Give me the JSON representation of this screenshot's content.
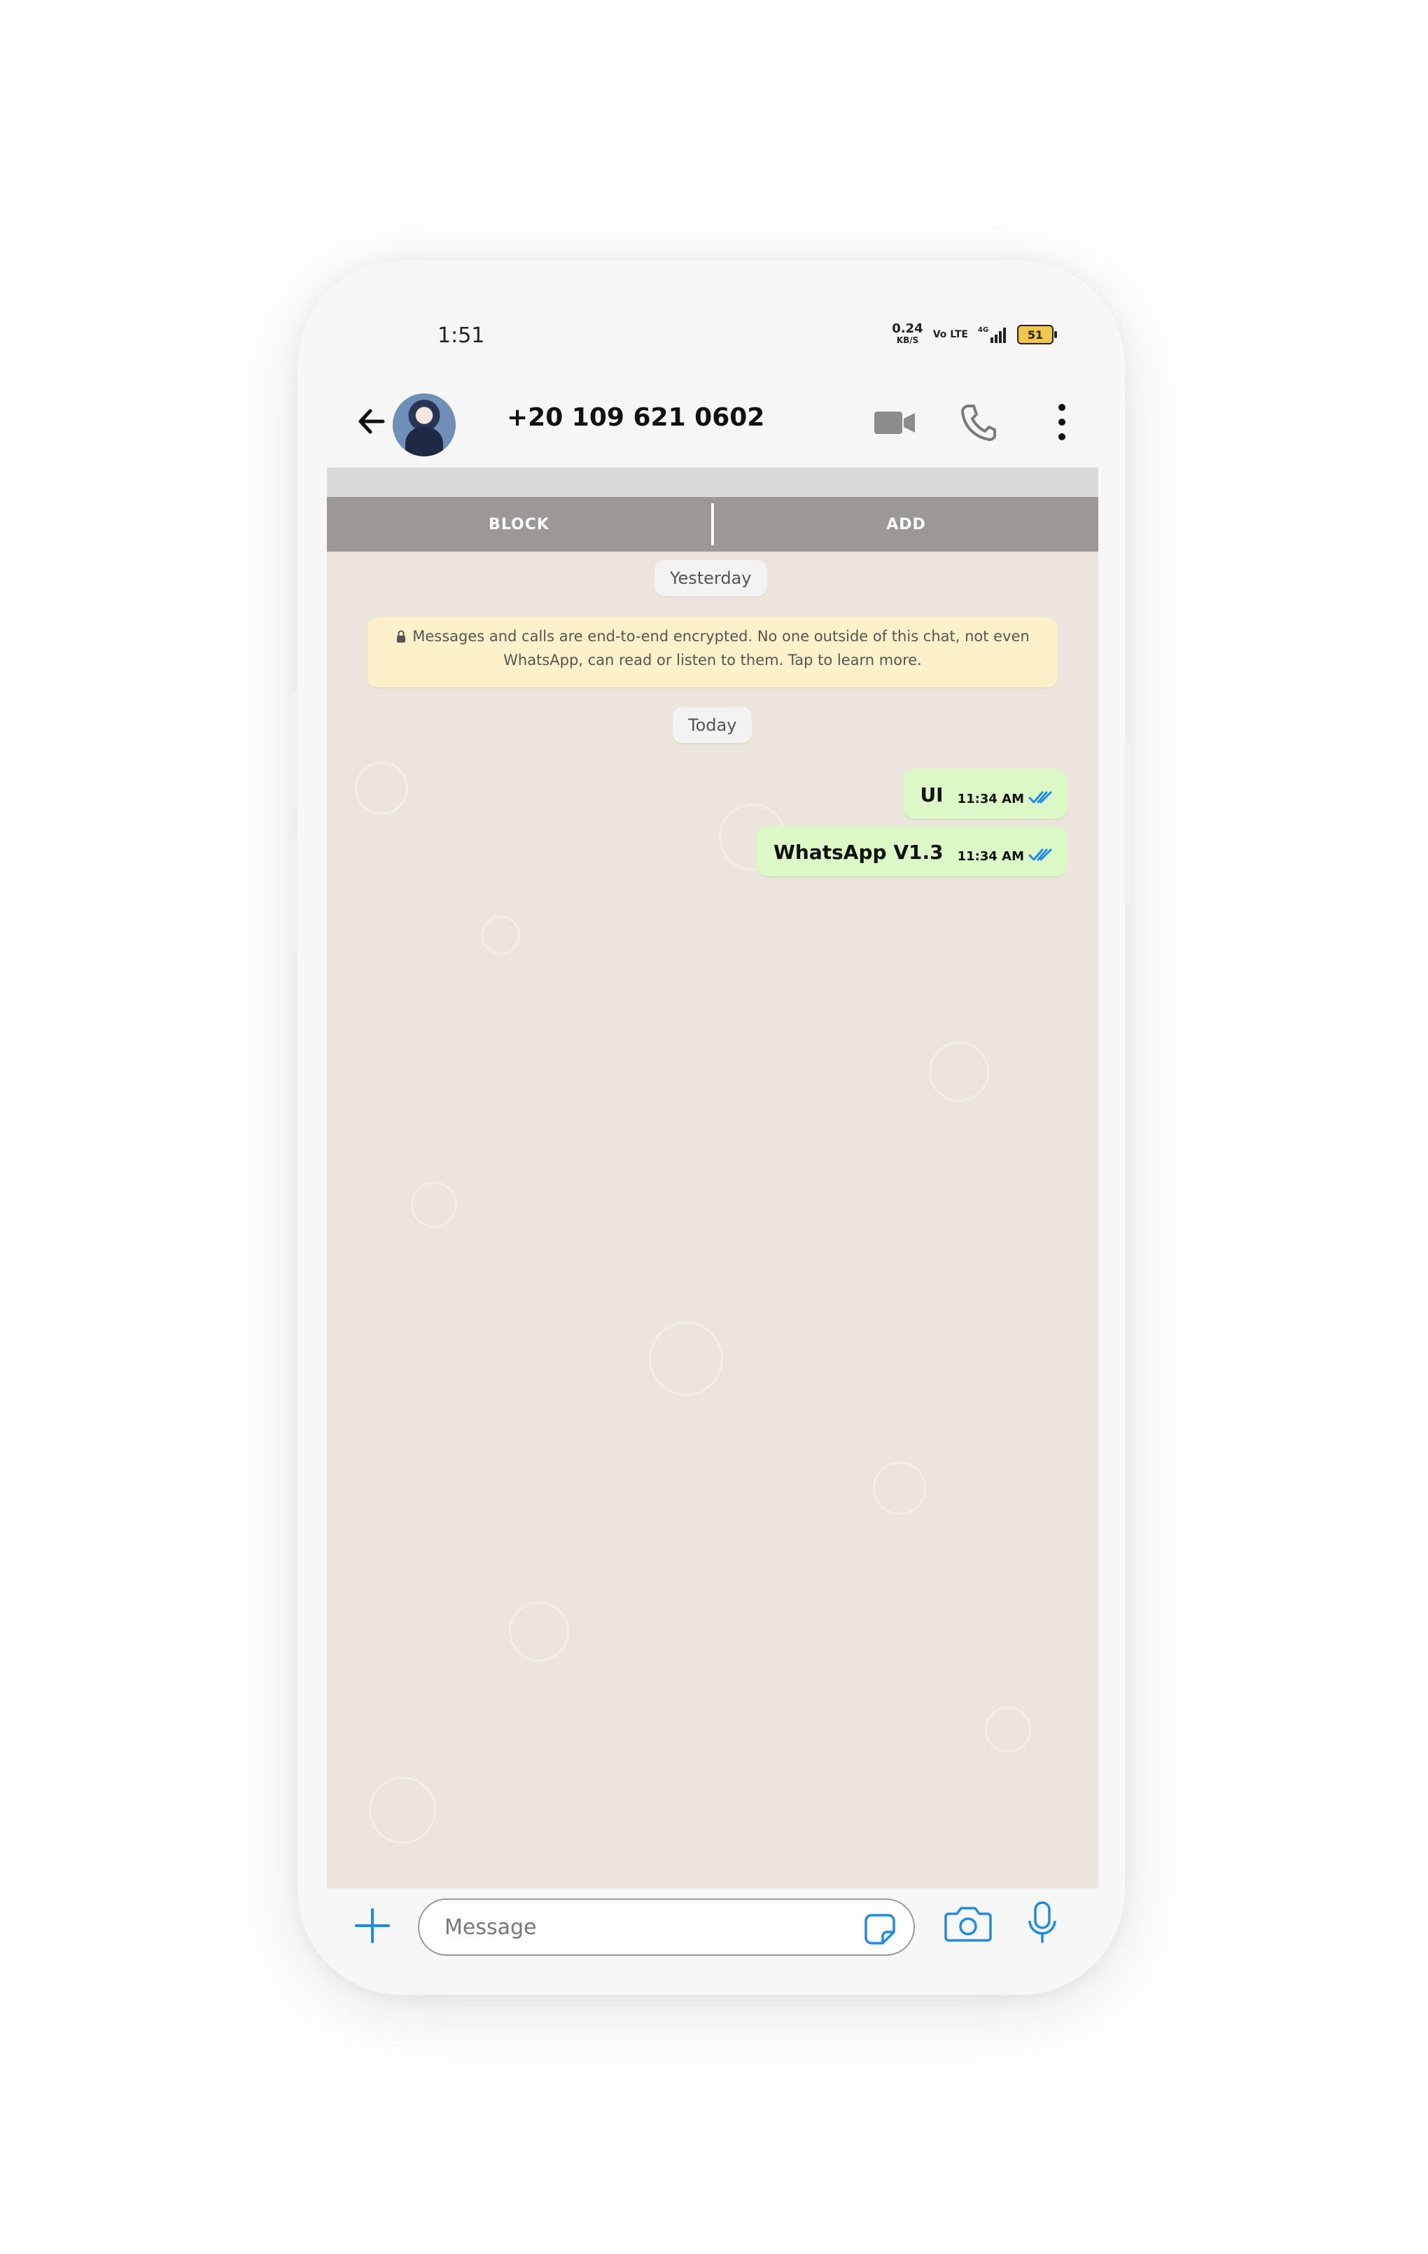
{
  "status_bar": {
    "time": "1:51",
    "net_speed": "0.24",
    "net_unit": "KB/S",
    "volte": "Vo LTE",
    "signal": "4G",
    "battery": "51"
  },
  "header": {
    "contact": "+20 109 621 0602",
    "icons": [
      "back-arrow-icon",
      "avatar",
      "video-call-icon",
      "phone-icon",
      "more-vertical-icon"
    ]
  },
  "actions": {
    "block": "BLOCK",
    "add": "ADD"
  },
  "chat": {
    "date_yesterday": "Yesterday",
    "encryption_notice": "Messages and calls are end-to-end encrypted. No one outside of this chat, not even WhatsApp, can read or listen to them. Tap to learn more.",
    "date_today": "Today",
    "messages": [
      {
        "text": "UI",
        "time": "11:34 AM",
        "status": "read"
      },
      {
        "text": "WhatsApp V1.3",
        "time": "11:34 AM",
        "status": "read"
      }
    ]
  },
  "composer": {
    "placeholder": "Message"
  },
  "colors": {
    "chat_background": "#ece5dd",
    "bubble_out": "#dcf8c6",
    "notice": "#fdf1c9",
    "action_bar": "#9b9895",
    "accent_blue": "#1f8ae8"
  }
}
